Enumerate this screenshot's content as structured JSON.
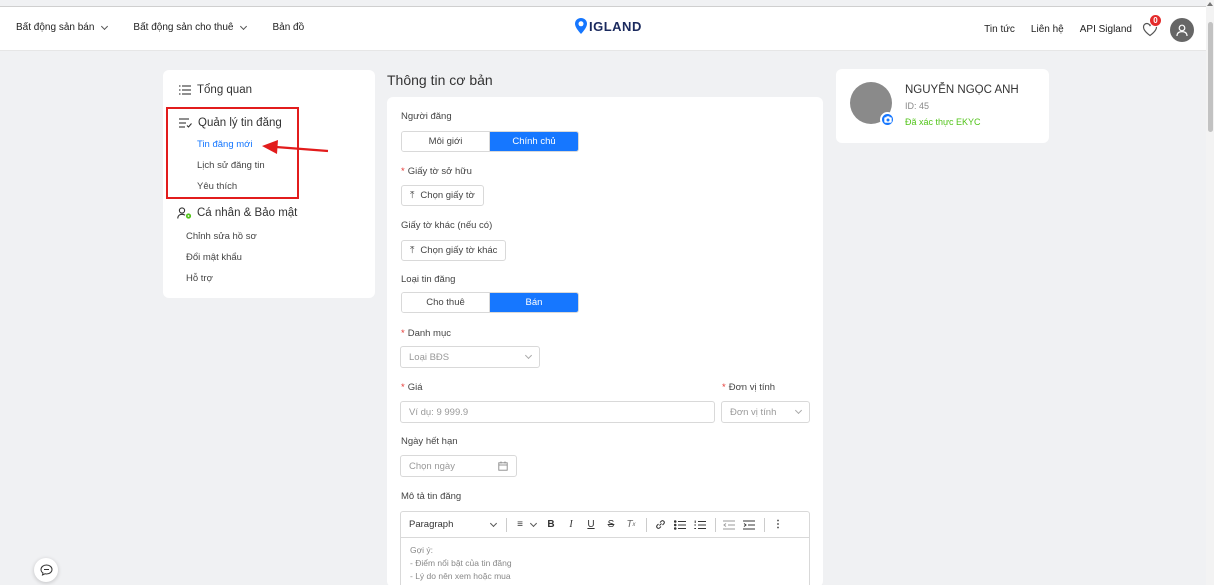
{
  "header": {
    "nav_left": [
      {
        "label": "Bất động sản bán",
        "has_dropdown": true
      },
      {
        "label": "Bất động sản cho thuê",
        "has_dropdown": true
      },
      {
        "label": "Bản đồ",
        "has_dropdown": false
      }
    ],
    "logo_text": "IGLAND",
    "nav_right": [
      {
        "label": "Tin tức"
      },
      {
        "label": "Liên hệ"
      },
      {
        "label": "API Sigland"
      }
    ],
    "favorites_count": "0"
  },
  "sidebar": {
    "groups": [
      {
        "icon": "list-icon",
        "label": "Tổng quan",
        "items": []
      },
      {
        "icon": "post-manage-icon",
        "label": "Quản lý tin đăng",
        "items": [
          "Tin đăng mới",
          "Lịch sử đăng tin",
          "Yêu thích"
        ],
        "active": "Tin đăng mới"
      },
      {
        "icon": "user-settings-icon",
        "label": "Cá nhân & Bảo mật",
        "items": [
          "Chỉnh sửa hồ sơ",
          "Đổi mật khẩu",
          "Hỗ trợ"
        ]
      }
    ]
  },
  "form": {
    "section_title": "Thông tin cơ bản",
    "poster": {
      "label": "Người đăng",
      "options": [
        "Môi giới",
        "Chính chủ"
      ],
      "selected": "Chính chủ"
    },
    "ownership_doc": {
      "label": "Giấy tờ sở hữu",
      "required": true,
      "button": "Chọn giấy tờ"
    },
    "other_doc": {
      "label": "Giấy tờ khác (nếu có)",
      "button": "Chọn giấy tờ khác"
    },
    "listing_type": {
      "label": "Loại tin đăng",
      "options": [
        "Cho thuê",
        "Bán"
      ],
      "selected": "Bán"
    },
    "category": {
      "label": "Danh mục",
      "required": true,
      "placeholder": "Loại BĐS"
    },
    "price": {
      "label": "Giá",
      "required": true,
      "placeholder": "Ví dụ: 9 999.9"
    },
    "unit": {
      "label": "Đơn vị tính",
      "required": true,
      "placeholder": "Đơn vị tính"
    },
    "expiry": {
      "label": "Ngày hết hạn",
      "placeholder": "Chọn ngày"
    },
    "description": {
      "label": "Mô tả tin đăng",
      "paragraph_style": "Paragraph",
      "hint_lines": [
        "Gợi ý:",
        "- Điểm nổi bật của tin đăng",
        "- Lý do nên xem hoặc mua"
      ]
    }
  },
  "profile": {
    "name": "NGUYỄN NGỌC ANH",
    "id_text": "ID: 45",
    "kyc_text": "Đã xác thực EKYC",
    "kyc_color": "#52c41a"
  },
  "colors": {
    "accent": "#1677ff",
    "highlight": "#e21c1c",
    "badge": "#e42b2b"
  }
}
